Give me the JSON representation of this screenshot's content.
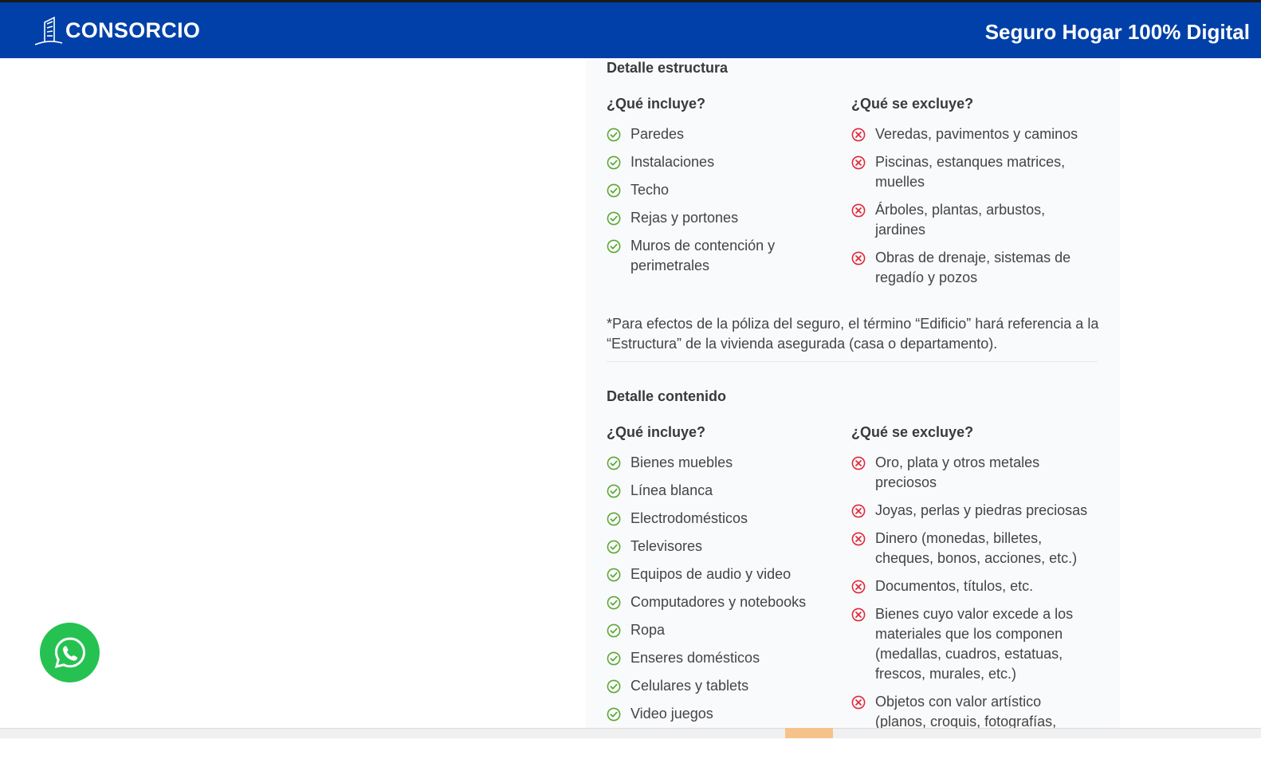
{
  "header": {
    "brand": "CONSORCIO",
    "title": "Seguro Hogar 100% Digital",
    "brand_color": "#0040a8"
  },
  "estructura": {
    "title": "Detalle estructura",
    "include_heading": "¿Qué incluye?",
    "exclude_heading": "¿Qué se excluye?",
    "includes": [
      "Paredes",
      "Instalaciones",
      "Techo",
      "Rejas y portones",
      "Muros de contención y perimetrales"
    ],
    "excludes": [
      "Veredas, pavimentos y caminos",
      "Piscinas, estanques matrices, muelles",
      "Árboles, plantas, arbustos, jardines",
      "Obras de drenaje, sistemas de regadío y pozos"
    ],
    "note": "*Para efectos de la póliza del seguro, el término “Edificio” hará referencia a la “Estructura” de la vivienda asegurada (casa o departamento)."
  },
  "contenido": {
    "title": "Detalle contenido",
    "include_heading": "¿Qué incluye?",
    "exclude_heading": "¿Qué se excluye?",
    "includes": [
      "Bienes muebles",
      "Línea blanca",
      "Electrodomésticos",
      "Televisores",
      "Equipos de audio y video",
      "Computadores y notebooks",
      "Ropa",
      "Enseres domésticos",
      "Celulares y tablets",
      "Video juegos"
    ],
    "excludes": [
      "Oro, plata y otros metales preciosos",
      "Joyas, perlas y piedras preciosas",
      "Dinero (monedas, billetes, cheques, bonos, acciones, etc.)",
      "Documentos, títulos, etc.",
      "Bienes cuyo valor excede a los materiales que los componen (medallas, cuadros, estatuas, frescos, murales, etc.)",
      "Objetos con valor artístico (planos, croquis, fotografías,"
    ]
  },
  "colors": {
    "include_icon": "#5aa832",
    "exclude_icon": "#e0293a",
    "whatsapp": "#25c252"
  },
  "icons": {
    "include": "check-circle-icon",
    "exclude": "x-circle-icon",
    "chat": "whatsapp-icon"
  }
}
